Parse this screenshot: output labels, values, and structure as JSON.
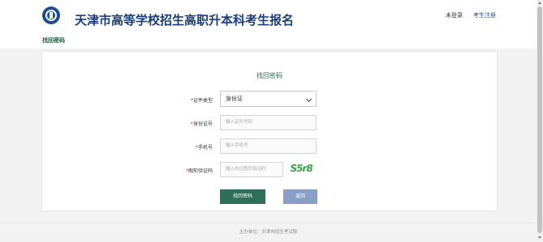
{
  "header": {
    "title": "天津市高等学校招生高职升本科考生报名",
    "status": "未登录",
    "register_link": "考生注册"
  },
  "breadcrumb": "找回密码",
  "form": {
    "title": "找回密码",
    "id_type": {
      "label": "证件类型",
      "value": "身份证"
    },
    "id_number": {
      "label": "身份证号",
      "placeholder": "输入证件号码"
    },
    "phone": {
      "label": "手机号",
      "placeholder": "输入手机号"
    },
    "captcha": {
      "label": "图形验证码",
      "placeholder": "输入右边图形验证码",
      "image_text": "S5r8"
    },
    "submit_label": "找回密码",
    "back_label": "返回"
  },
  "footer": "主办单位：天津市招生考试院",
  "colors": {
    "brand": "#1b3e7a",
    "primary_button": "#2f6f5a",
    "back_button": "#8a9ec6",
    "required": "#e02020"
  }
}
